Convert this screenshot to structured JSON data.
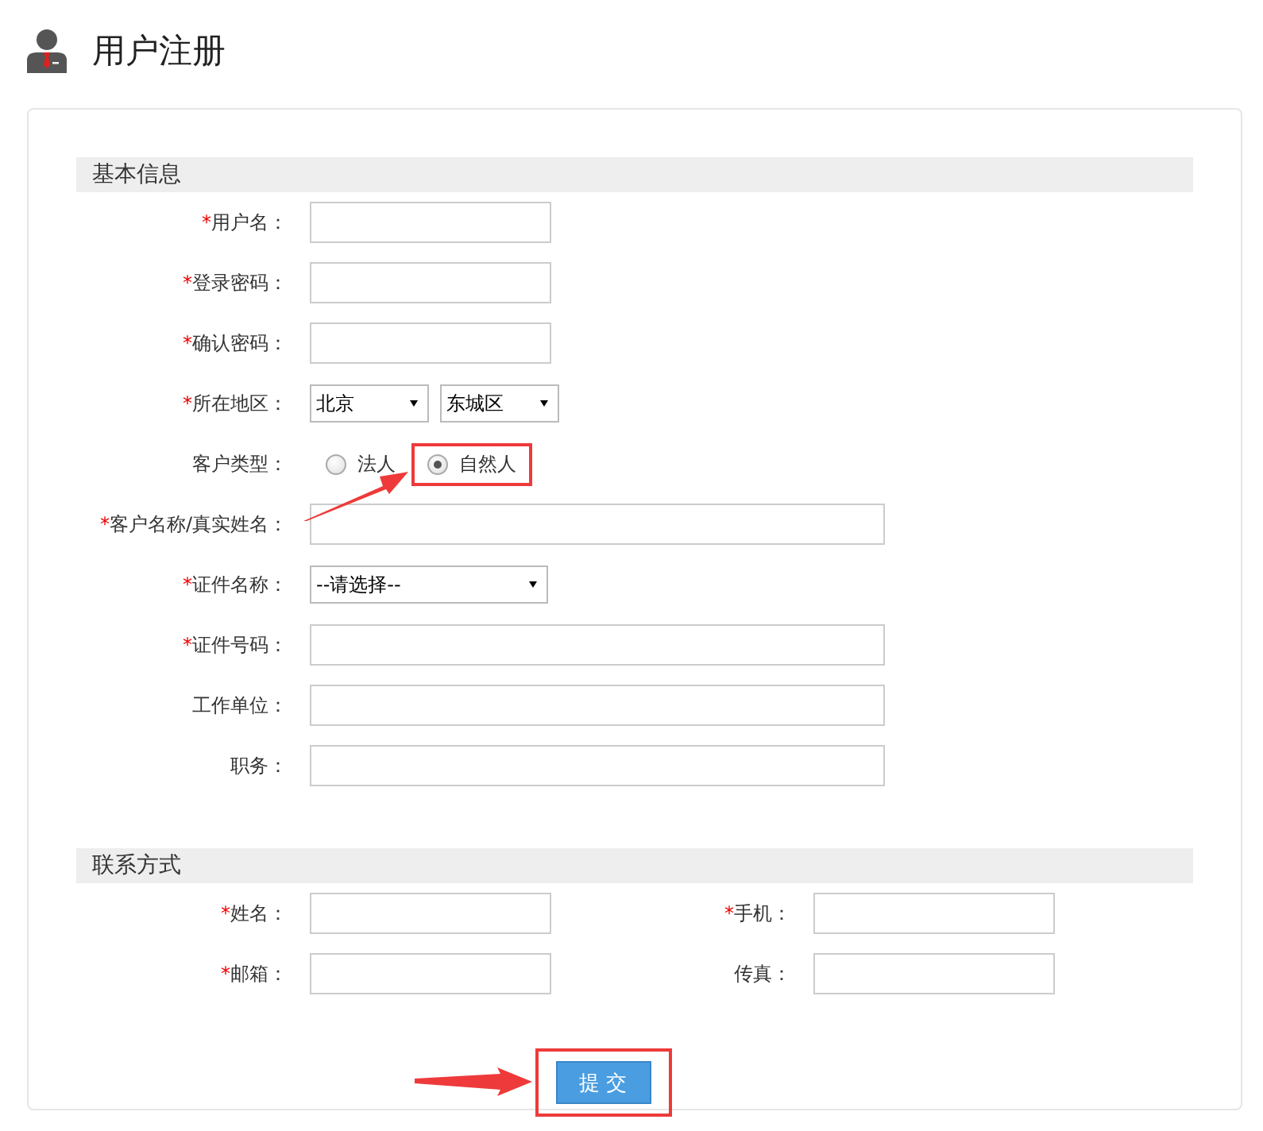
{
  "header": {
    "title": "用户注册"
  },
  "sections": [
    {
      "title": "基本信息",
      "kind": "single",
      "fields": [
        {
          "kind": "short",
          "mark": "*",
          "label": "用户名："
        },
        {
          "kind": "short",
          "mark": "*",
          "label": "登录密码："
        },
        {
          "kind": "short",
          "mark": "*",
          "label": "确认密码："
        },
        {
          "kind": "select",
          "mark": "*",
          "label": "所在地区：",
          "selects": [
            {
              "kind": "narrow",
              "value": "北京"
            },
            {
              "kind": "narrow",
              "value": "东城区"
            }
          ]
        },
        {
          "kind": "radio",
          "label": "客户类型：",
          "options": [
            {
              "label": "法人",
              "selected": false,
              "highlighted": false
            },
            {
              "label": "自然人",
              "selected": true,
              "highlighted": true
            }
          ]
        },
        {
          "kind": "long",
          "mark": "*",
          "label": "客户名称/真实姓名："
        },
        {
          "kind": "select",
          "mark": "*",
          "label": "证件名称：",
          "selects": [
            {
              "kind": "wide",
              "value": "--请选择--"
            }
          ]
        },
        {
          "kind": "long",
          "mark": "*",
          "label": "证件号码："
        },
        {
          "kind": "long",
          "label": "工作单位："
        },
        {
          "kind": "long",
          "label": "职务："
        }
      ]
    },
    {
      "title": "联系方式",
      "kind": "grid",
      "fields": [
        {
          "kind": "short",
          "mark": "*",
          "label": "姓名："
        },
        {
          "kind": "short",
          "mark": "*",
          "label": "手机："
        },
        {
          "kind": "short",
          "mark": "*",
          "label": "邮箱："
        },
        {
          "kind": "short",
          "label": "传真："
        }
      ]
    }
  ],
  "submit": {
    "label": "提 交",
    "highlighted": true
  }
}
